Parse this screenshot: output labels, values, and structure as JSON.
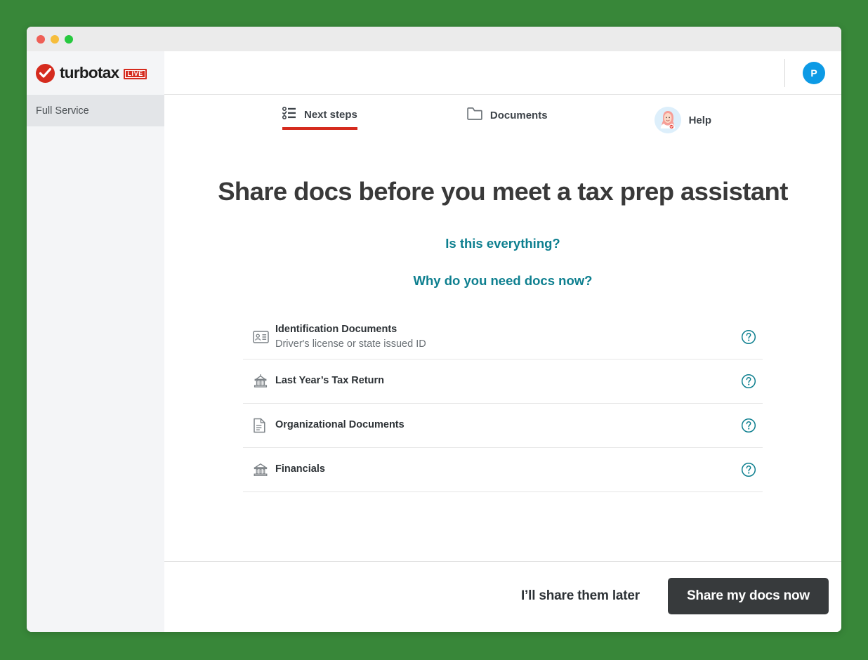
{
  "window": {
    "traffic_lights": [
      "close",
      "minimize",
      "maximize"
    ]
  },
  "brand": {
    "wordmark": "turbotax",
    "badge": "LIVE",
    "check_icon": "check-icon"
  },
  "sidebar": {
    "items": [
      {
        "label": "Full Service",
        "active": true
      }
    ]
  },
  "header": {
    "avatar_initial": "P",
    "avatar_color": "#0d9ae5"
  },
  "tabs": [
    {
      "label": "Next steps",
      "icon": "checklist-icon",
      "active": true
    },
    {
      "label": "Documents",
      "icon": "folder-icon",
      "active": false
    },
    {
      "label": "Help",
      "icon": "agent-avatar-icon",
      "active": false
    }
  ],
  "main": {
    "title": "Share docs before you meet a tax prep assistant",
    "links": [
      {
        "label": "Is this everything?"
      },
      {
        "label": "Why do you need docs now?"
      }
    ],
    "documents": [
      {
        "title": "Identification Documents",
        "subtitle": "Driver's license or state issued ID",
        "icon": "id-card-icon",
        "help": "help-circle-icon"
      },
      {
        "title": "Last Year’s Tax Return",
        "subtitle": "",
        "icon": "government-building-icon",
        "help": "help-circle-icon"
      },
      {
        "title": "Organizational Documents",
        "subtitle": "",
        "icon": "document-icon",
        "help": "help-circle-icon"
      },
      {
        "title": "Financials",
        "subtitle": "",
        "icon": "bank-icon",
        "help": "help-circle-icon"
      }
    ]
  },
  "footer": {
    "secondary_label": "I’ll share them later",
    "primary_label": "Share my docs now"
  },
  "colors": {
    "backdrop_green": "#388739",
    "brand_red": "#d52b1e",
    "teal_link": "#0d7f8f",
    "primary_button": "#373a3c"
  }
}
